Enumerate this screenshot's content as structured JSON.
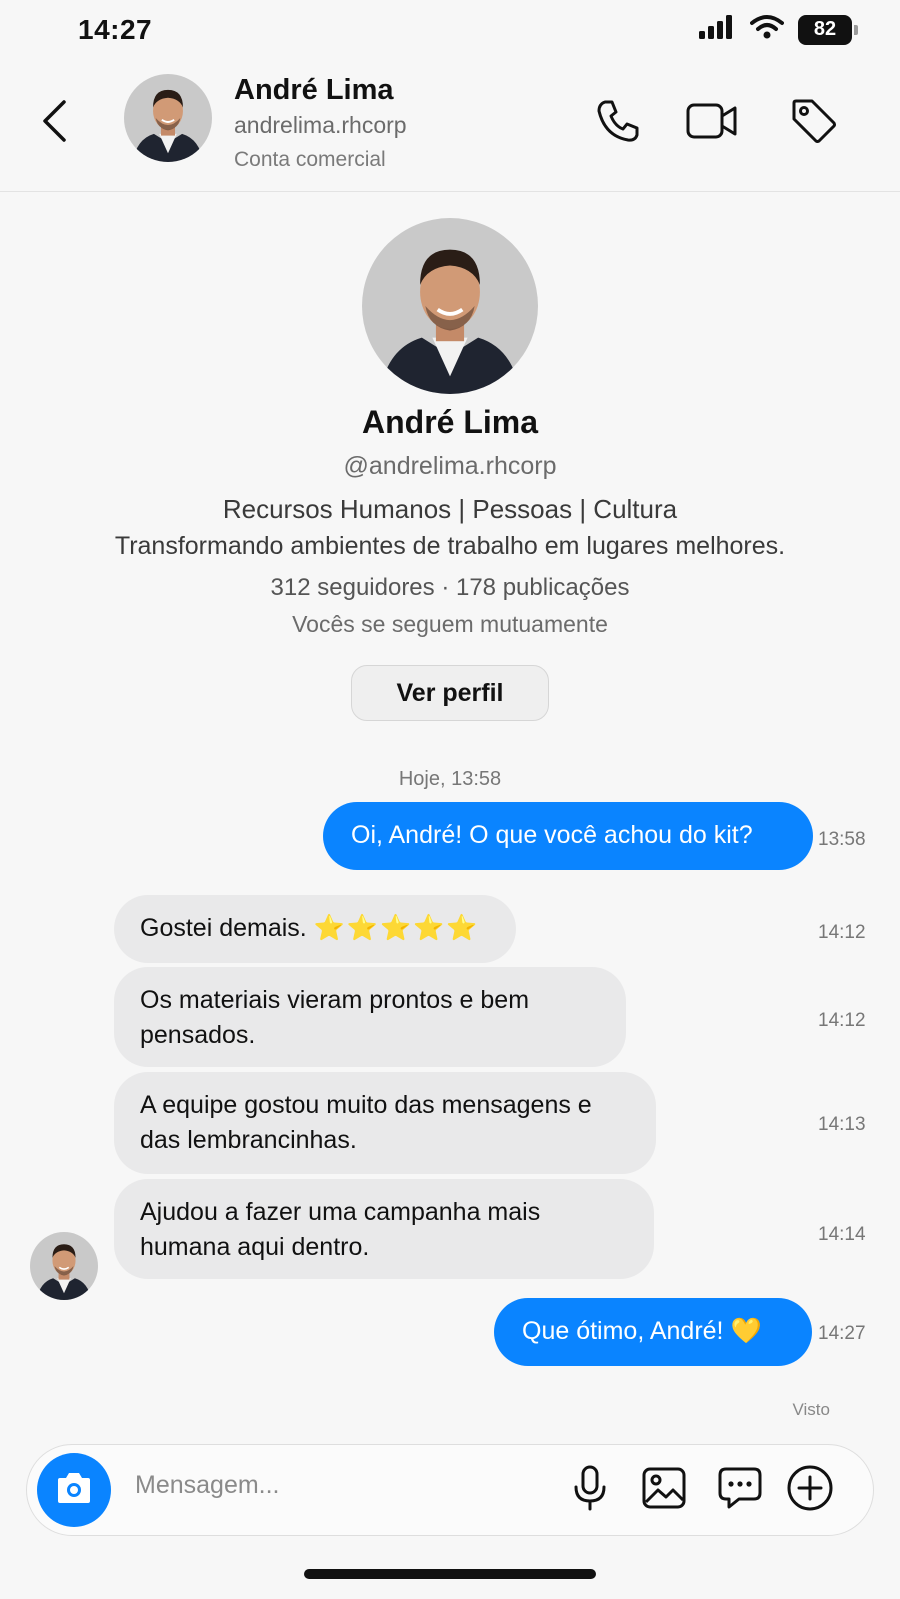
{
  "status_bar": {
    "time": "14:27",
    "battery": "82"
  },
  "header": {
    "name": "André Lima",
    "handle": "andrelima.rhcorp",
    "subtitle": "Conta comercial"
  },
  "profile": {
    "name": "André Lima",
    "handle": "@andrelima.rhcorp",
    "tags": "Recursos Humanos | Pessoas | Cultura",
    "bio": "Transformando ambientes de trabalho em lugares melhores.",
    "stats": "312 seguidores · 178 publicações",
    "mutual": "Vocês se seguem mutuamente",
    "view_button": "Ver perfil"
  },
  "chat": {
    "date_separator": "Hoje, 13:58",
    "messages": [
      {
        "direction": "out",
        "text": "Oi, André! O que você achou do kit?",
        "time": "13:58"
      },
      {
        "direction": "in",
        "text": "Gostei demais.",
        "emoji": "⭐⭐⭐⭐⭐",
        "time": "14:12"
      },
      {
        "direction": "in",
        "text": "Os materiais vieram prontos e bem pensados.",
        "time": "14:12"
      },
      {
        "direction": "in",
        "text": "A equipe gostou muito das mensagens e das lembrancinhas.",
        "time": "14:13"
      },
      {
        "direction": "in",
        "text": "Ajudou a fazer uma campanha mais humana aqui dentro.",
        "time": "14:14"
      },
      {
        "direction": "out",
        "text": "Que ótimo, André! 💛",
        "time": "14:27"
      }
    ],
    "seen_label": "Visto"
  },
  "composer": {
    "placeholder": "Mensagem..."
  },
  "icons": {
    "back": "chevron-left-icon",
    "call": "phone-icon",
    "video": "video-camera-icon",
    "tag": "tag-icon",
    "camera": "camera-icon",
    "mic": "microphone-icon",
    "gallery": "image-icon",
    "sticker": "chat-bubble-icon",
    "plus": "plus-circle-icon"
  },
  "colors": {
    "accent": "#0a84ff",
    "incoming_bubble": "#e9e9ea",
    "background": "#f7f7f7"
  }
}
